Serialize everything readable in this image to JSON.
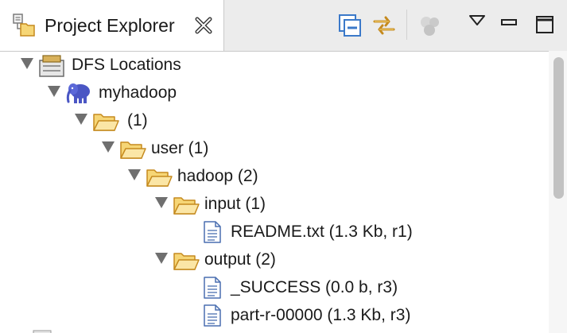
{
  "view": {
    "tab_title": "Project Explorer",
    "tab_icon": "project-explorer-icon",
    "close_icon": "close-x-icon"
  },
  "toolbar": {
    "buttons": [
      {
        "name": "collapse-all-button",
        "icon": "collapse-all-icon"
      },
      {
        "name": "link-with-editor-button",
        "icon": "link-with-editor-icon"
      },
      {
        "name": "hadoop-button",
        "icon": "hadoop-disabled-icon"
      },
      {
        "name": "view-menu-button",
        "icon": "triangle-down-icon"
      },
      {
        "name": "minimize-button",
        "icon": "minimize-icon"
      },
      {
        "name": "maximize-button",
        "icon": "maximize-icon"
      }
    ]
  },
  "tree": {
    "items": [
      {
        "label": "DFS Locations",
        "icon": "dfs-locations-icon",
        "expanded": true
      },
      {
        "label": "myhadoop",
        "icon": "elephant-icon",
        "expanded": true
      },
      {
        "label": "(1)",
        "icon": "folder-open-icon",
        "expanded": true
      },
      {
        "label": "user (1)",
        "icon": "folder-open-icon",
        "expanded": true
      },
      {
        "label": "hadoop (2)",
        "icon": "folder-open-icon",
        "expanded": true
      },
      {
        "label": "input (1)",
        "icon": "folder-open-icon",
        "expanded": true
      },
      {
        "label": "README.txt (1.3 Kb, r1)",
        "icon": "file-icon"
      },
      {
        "label": "output (2)",
        "icon": "folder-open-icon",
        "expanded": true
      },
      {
        "label": "_SUCCESS (0.0 b, r3)",
        "icon": "file-icon"
      },
      {
        "label": "part-r-00000 (1.3 Kb, r3)",
        "icon": "file-icon"
      }
    ]
  },
  "colors": {
    "folder_fill": "#f6d676",
    "folder_stroke": "#c58a1e",
    "elephant": "#4a56c4",
    "twisty": "#6f6f6f",
    "selection_blue": "#3b79c9"
  }
}
